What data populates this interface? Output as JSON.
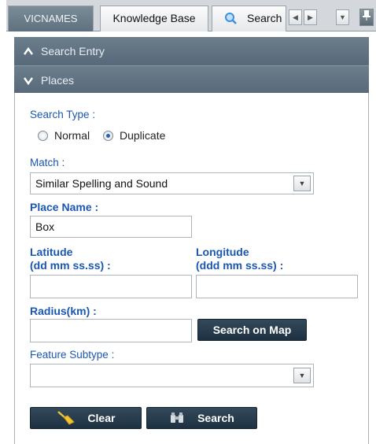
{
  "tabs": {
    "vicnames": "VICNAMES",
    "knowledge_base": "Knowledge Base",
    "search": "Search"
  },
  "accordion": {
    "search_entry": "Search Entry",
    "places": "Places"
  },
  "form": {
    "search_type_label": "Search Type :",
    "radio_normal": "Normal",
    "radio_duplicate": "Duplicate",
    "selected_type": "Duplicate",
    "match_label": "Match :",
    "match_value": "Similar Spelling and Sound",
    "place_name_label": "Place Name :",
    "place_name_value": "Box",
    "latitude_label_1": "Latitude",
    "latitude_label_2": "(dd mm ss.ss) :",
    "latitude_value": "",
    "longitude_label_1": "Longitude",
    "longitude_label_2": "(ddd mm ss.ss) :",
    "longitude_value": "",
    "radius_label": "Radius(km) :",
    "radius_value": "",
    "search_on_map": "Search on Map",
    "feature_subtype_label": "Feature Subtype :",
    "feature_subtype_value": "",
    "clear_button": "Clear",
    "search_button": "Search"
  },
  "icons": {
    "search_tab": "magnifier-icon",
    "clear": "broom-icon",
    "search": "binoculars-icon",
    "pin": "pin-icon"
  }
}
